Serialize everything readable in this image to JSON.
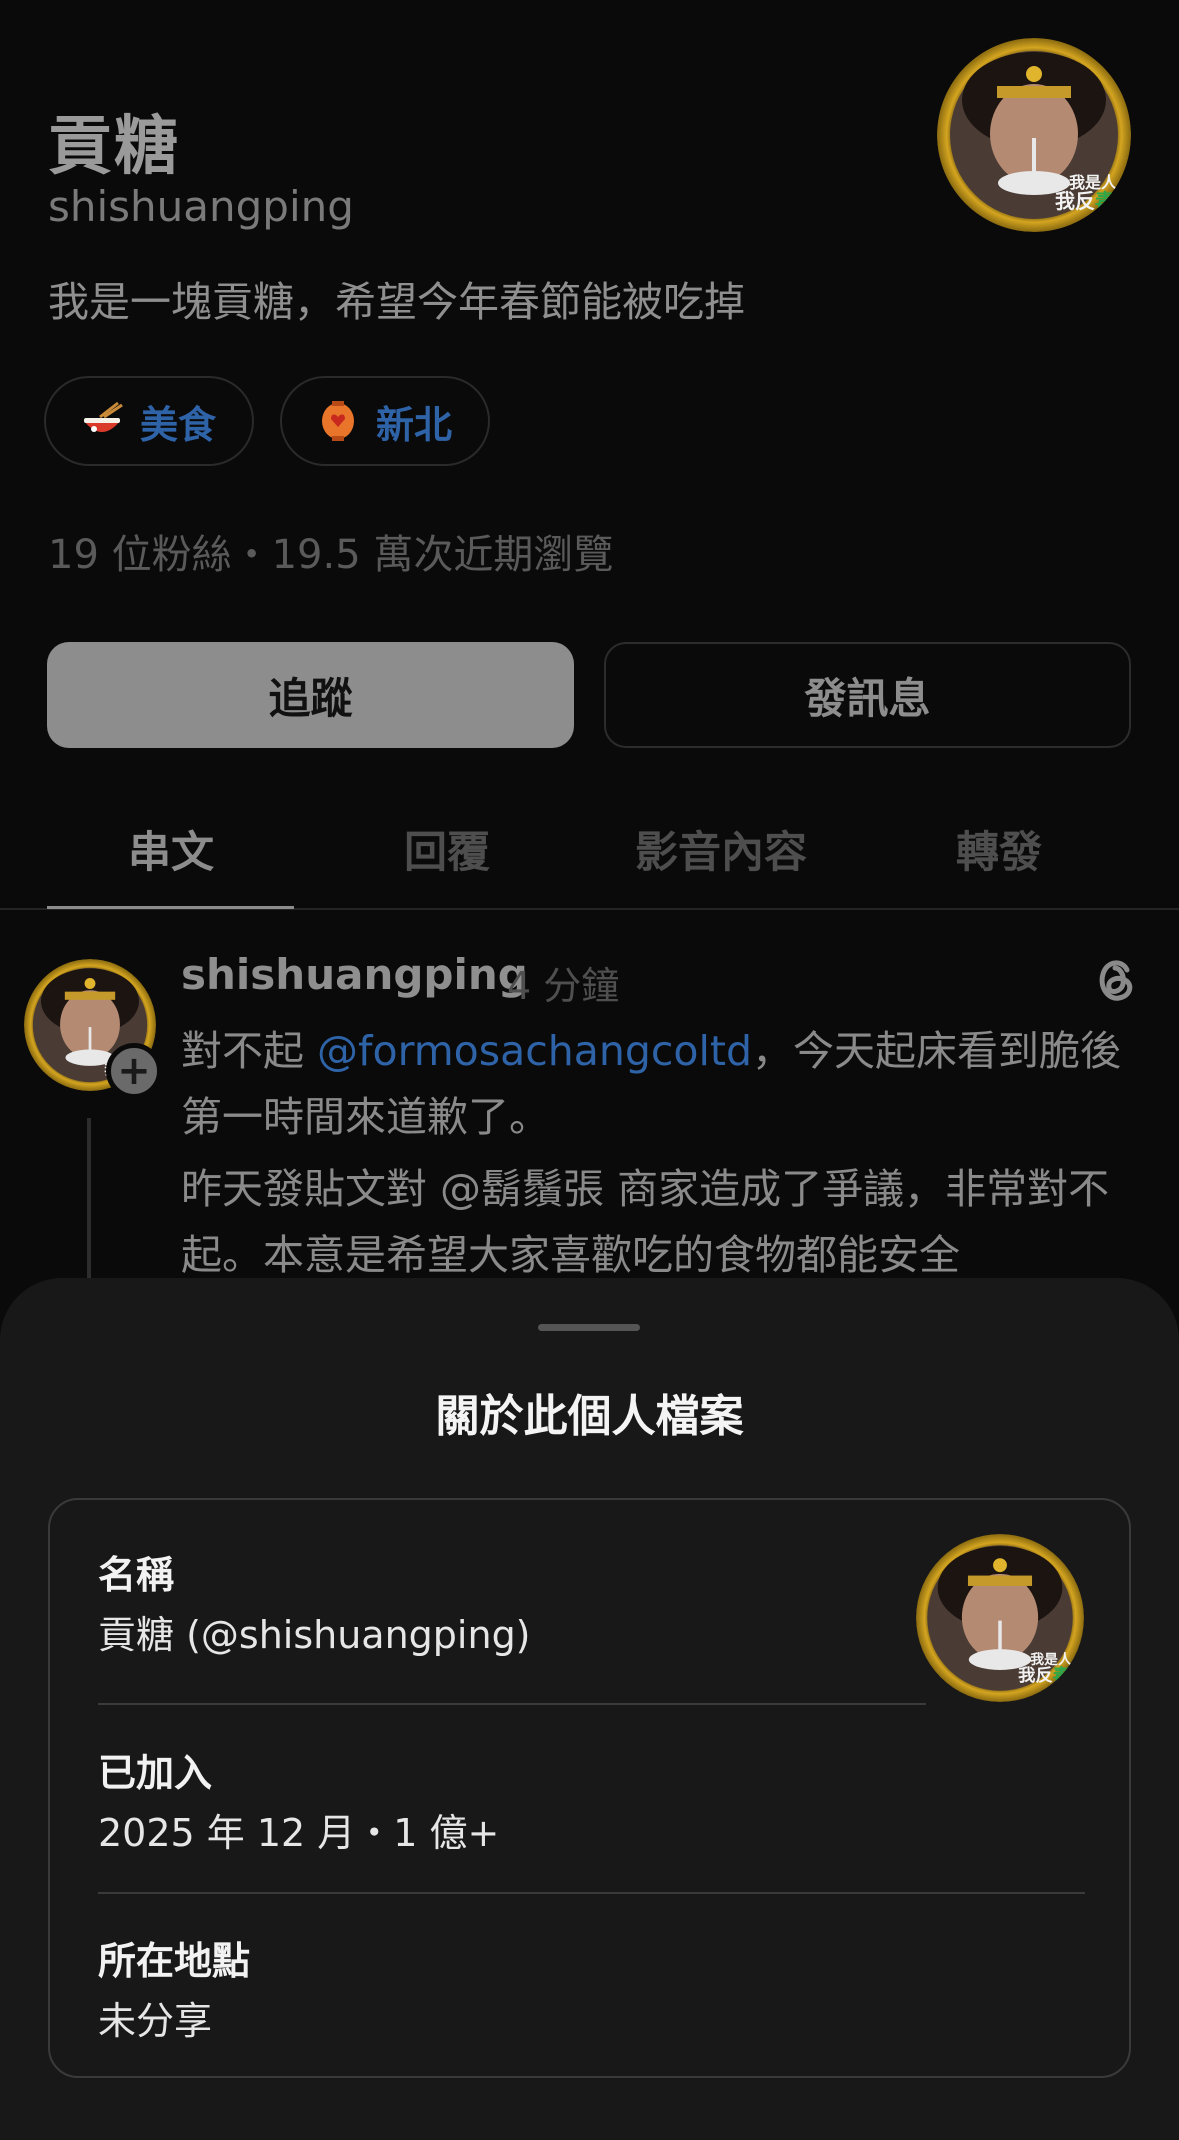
{
  "profile": {
    "display_name": "貢糖",
    "username": "shishuangping",
    "bio": "我是一塊貢糖，希望今年春節能被吃掉",
    "avatar_caption_lines": [
      "我是人",
      "我反毒台"
    ],
    "tags": [
      {
        "icon": "ramen-bowl-icon",
        "label": "美食"
      },
      {
        "icon": "lantern-icon",
        "label": "新北"
      }
    ],
    "stats": "19 位粉絲・19.5 萬次近期瀏覽",
    "follow_label": "追蹤",
    "message_label": "發訊息"
  },
  "tabs": [
    {
      "label": "串文",
      "active": true
    },
    {
      "label": "回覆",
      "active": false
    },
    {
      "label": "影音內容",
      "active": false
    },
    {
      "label": "轉發",
      "active": false
    }
  ],
  "post": {
    "author": "shishuangping",
    "time": "4 分鐘",
    "para1_before": "對不起 ",
    "para1_mention": "@formosachangcoltd",
    "para1_after": "，今天起床看到脆後 第一時間來道歉了。",
    "para2": "昨天發貼文對 @鬍鬚張 商家造成了爭議，非常對不起。本意是希望大家喜歡吃的食物都能安全"
  },
  "sheet": {
    "title": "關於此個人檔案",
    "name_label": "名稱",
    "name_value": "貢糖 (@shishuangping)",
    "joined_label": "已加入",
    "joined_value": "2025 年 12 月・1 億+",
    "location_label": "所在地點",
    "location_value": "未分享"
  },
  "colors": {
    "background": "#0a0a0a",
    "sheet_background": "#181818",
    "link_blue": "#2f63a8",
    "avatar_ring_gold": "#d4a520"
  }
}
